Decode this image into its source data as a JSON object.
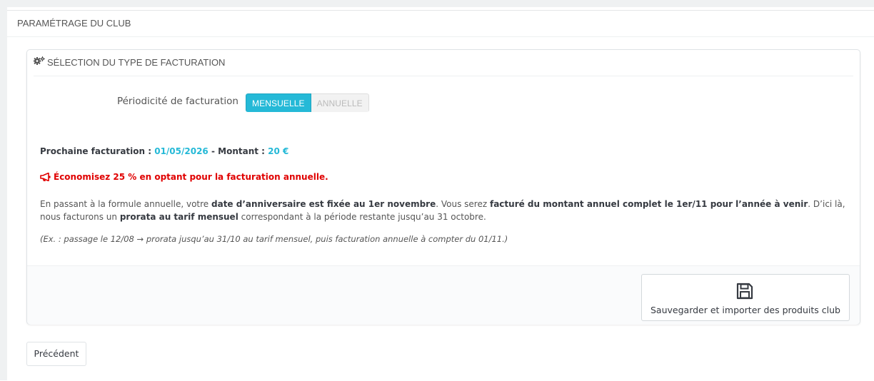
{
  "outer_panel": {
    "title": "PARAMÉTRAGE DU CLUB"
  },
  "inner_panel": {
    "title": "SÉLECTION DU TYPE DE FACTURATION",
    "icon": "gears-icon"
  },
  "periodicity": {
    "label": "Périodicité de facturation",
    "options": [
      "MENSUELLE",
      "ANNUELLE"
    ],
    "selected": "MENSUELLE"
  },
  "billing": {
    "next_label": "Prochaine facturation :",
    "next_date": "01/05/2026",
    "separator": "-",
    "amount_label": "Montant :",
    "amount": "20 €"
  },
  "promo": {
    "icon": "bullhorn-icon",
    "text": "Économisez 25 % en optant pour la facturation annuelle."
  },
  "description": {
    "p1": "En passant à la formule annuelle, votre ",
    "b1": "date d’anniversaire est fixée au 1er novembre",
    "p2": ". Vous serez ",
    "b2": "facturé du montant annuel complet le 1er/11 pour l’année à venir",
    "p3": ". D’ici là, nous facturons un ",
    "b3": "prorata au tarif mensuel",
    "p4": " correspondant à la période restante jusqu’au 31 octobre."
  },
  "example": "(Ex. : passage le 12/08 → prorata jusqu’au 31/10 au tarif mensuel, puis facturation annuelle à compter du 01/11.)",
  "actions": {
    "save_label": "Sauvegarder et importer des produits club",
    "save_icon": "floppy-disk-icon",
    "previous_label": "Précédent"
  },
  "colors": {
    "accent": "#25b9d7",
    "promo": "#e00000",
    "text": "#555555"
  }
}
